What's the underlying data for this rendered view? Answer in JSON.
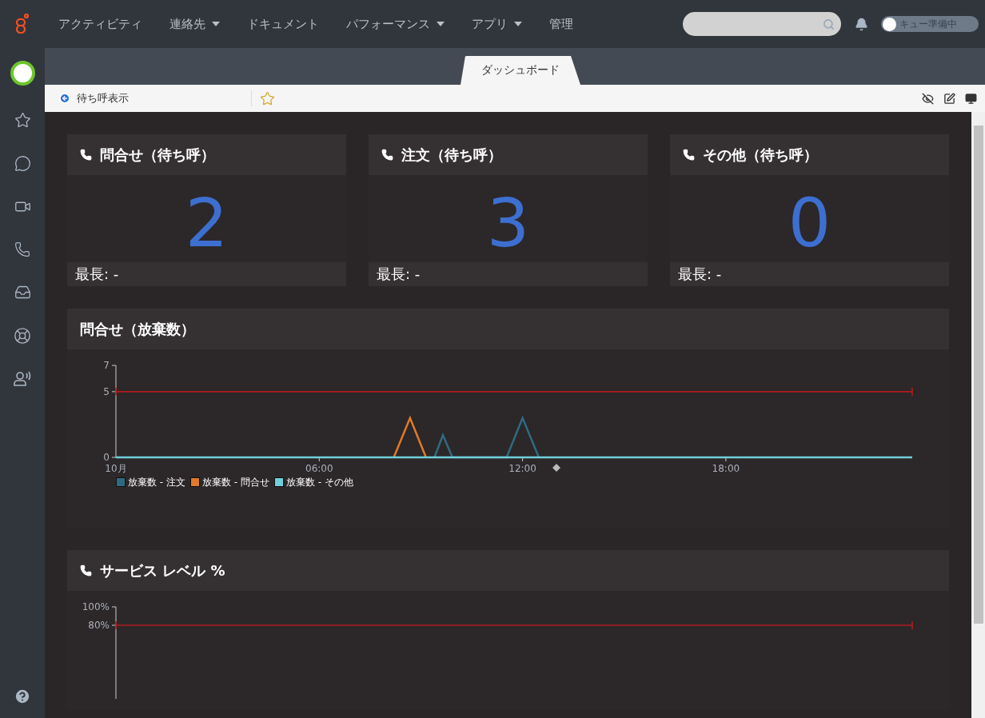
{
  "nav": {
    "items": [
      {
        "label": "アクティビティ",
        "has_menu": false
      },
      {
        "label": "連絡先",
        "has_menu": true
      },
      {
        "label": "ドキュメント",
        "has_menu": false
      },
      {
        "label": "パフォーマンス",
        "has_menu": true
      },
      {
        "label": "アプリ",
        "has_menu": true
      },
      {
        "label": "管理",
        "has_menu": false
      }
    ],
    "queue_toggle": {
      "label": "キュー準備中",
      "on": false
    }
  },
  "tabs": [
    {
      "label": "ダッシュボード",
      "selected": true
    }
  ],
  "toolbar": {
    "back_label": "待ち呼表示",
    "favorite": false
  },
  "cards": [
    {
      "title": "問合せ（待ち呼）",
      "value": "2",
      "footer": "最長: -"
    },
    {
      "title": "注文（待ち呼）",
      "value": "3",
      "footer": "最長: -"
    },
    {
      "title": "その他（待ち呼）",
      "value": "0",
      "footer": "最長: -"
    }
  ],
  "panels": [
    {
      "title": "問合せ（放棄数）",
      "phone_icon": false,
      "date_label": "10月",
      "chart_data": {
        "type": "line",
        "x": [
          0,
          8.2,
          8.68,
          9.15,
          9.4,
          9.65,
          9.93,
          11.53,
          12.0,
          12.48,
          23.5
        ],
        "xlim": [
          0,
          23.5
        ],
        "ylim": [
          0,
          7
        ],
        "yticks": [
          0,
          5,
          7
        ],
        "xticks": [
          {
            "value": 6,
            "label": "06:00"
          },
          {
            "value": 12,
            "label": "12:00"
          },
          {
            "value": 18,
            "label": "18:00"
          }
        ],
        "series": [
          {
            "name": "放棄数 - 注文",
            "color": "#2f6b80",
            "values": [
              null,
              null,
              null,
              null,
              0,
              1.7,
              0,
              0,
              3,
              0,
              null
            ]
          },
          {
            "name": "放棄数 - 問合せ",
            "color": "#e07a2a",
            "values": [
              null,
              0,
              3,
              0,
              null,
              null,
              null,
              null,
              null,
              null,
              null
            ]
          },
          {
            "name": "放棄数 - その他",
            "color": "#6fd0dc",
            "values": [
              0,
              0,
              0,
              0,
              0,
              0,
              0,
              0,
              0,
              0,
              0
            ]
          }
        ],
        "ref_lines": [
          {
            "axis": "y",
            "value": 5
          }
        ]
      }
    },
    {
      "title": "サービス レベル %",
      "phone_icon": true,
      "chart_data": {
        "type": "line",
        "xlim": [
          0,
          23.5
        ],
        "ylim": [
          0,
          100
        ],
        "yticks": [
          {
            "value": 100,
            "label": "100%"
          },
          {
            "value": 80,
            "label": "80%"
          }
        ],
        "ref_lines": [
          {
            "axis": "y",
            "value": 80
          }
        ]
      }
    }
  ]
}
